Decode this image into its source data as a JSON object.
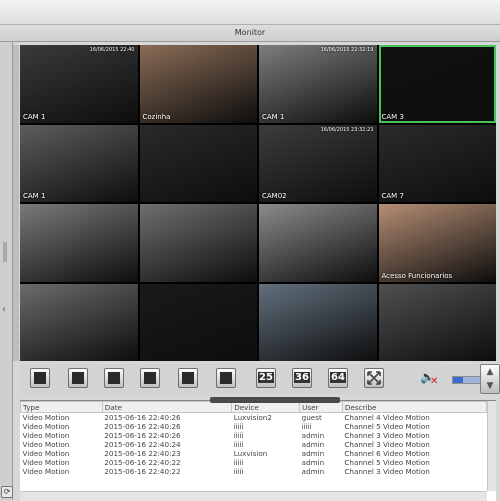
{
  "window": {
    "title": "Monitor"
  },
  "cameras": [
    {
      "label": "CAM 1",
      "timestamp": "16/06/2015 22:40",
      "tone": "#3a3a3a"
    },
    {
      "label": "Cozinha",
      "timestamp": "",
      "tone": "#8a6c56"
    },
    {
      "label": "CAM 1",
      "timestamp": "16/06/2015 22:32:19",
      "tone": "#7d7d7d"
    },
    {
      "label": "CAM 3",
      "timestamp": "",
      "tone": "#111111"
    },
    {
      "label": "CAM 1",
      "timestamp": "",
      "tone": "#5d5d5d"
    },
    {
      "label": "",
      "timestamp": "",
      "tone": "#2a2a2a"
    },
    {
      "label": "CAM02",
      "timestamp": "16/06/2015 23:32:23",
      "tone": "#3c3c3c"
    },
    {
      "label": "CAM 7",
      "timestamp": "",
      "tone": "#2b2b2b"
    },
    {
      "label": "",
      "timestamp": "",
      "tone": "#7a7a7a"
    },
    {
      "label": "",
      "timestamp": "",
      "tone": "#6f6f6f"
    },
    {
      "label": "",
      "timestamp": "",
      "tone": "#8b8b8b"
    },
    {
      "label": "Acesso Funcionarios",
      "timestamp": "",
      "tone": "#b58e74"
    },
    {
      "label": "",
      "timestamp": "",
      "tone": "#6b6b6b"
    },
    {
      "label": "",
      "timestamp": "",
      "tone": "#1a1a1a"
    },
    {
      "label": "",
      "timestamp": "",
      "tone": "#61707d"
    },
    {
      "label": "",
      "timestamp": "",
      "tone": "#505050"
    }
  ],
  "toolbar": {
    "layouts": [
      {
        "name": "layout-1",
        "text": ""
      },
      {
        "name": "layout-4",
        "text": ""
      },
      {
        "name": "layout-6",
        "text": ""
      },
      {
        "name": "layout-9",
        "text": ""
      },
      {
        "name": "layout-13",
        "text": ""
      },
      {
        "name": "layout-16",
        "text": ""
      },
      {
        "name": "layout-25",
        "text": "25"
      },
      {
        "name": "layout-36",
        "text": "36"
      },
      {
        "name": "layout-64",
        "text": "64"
      }
    ],
    "fullscreen_icon": "fullscreen-icon",
    "speaker_icon": "speaker-muted-icon",
    "volume_level": 0.2
  },
  "events_table": {
    "columns": [
      "Type",
      "Date",
      "Device",
      "User",
      "Describe"
    ],
    "rows": [
      [
        "Video Motion",
        "2015-06-16 22:40:26",
        "Luxvision2",
        "guest",
        "Channel 4 Video Motion"
      ],
      [
        "Video Motion",
        "2015-06-16 22:40:26",
        "iiiii",
        "iiiii",
        "Channel 5 Video Motion"
      ],
      [
        "Video Motion",
        "2015-06-16 22:40:26",
        "iiiii",
        "admin",
        "Channel 3 Video Motion"
      ],
      [
        "Video Motion",
        "2015-06-16 22:40:24",
        "iiiii",
        "admin",
        "Channel 3 Video Motion"
      ],
      [
        "Video Motion",
        "2015-06-16 22:40:23",
        "Luxvision",
        "admin",
        "Channel 6 Video Motion"
      ],
      [
        "Video Motion",
        "2015-06-16 22:40:22",
        "iiiii",
        "admin",
        "Channel 5 Video Motion"
      ],
      [
        "Video Motion",
        "2015-06-16 22:40:22",
        "iiiii",
        "admin",
        "Channel 3 Video Motion"
      ]
    ]
  }
}
